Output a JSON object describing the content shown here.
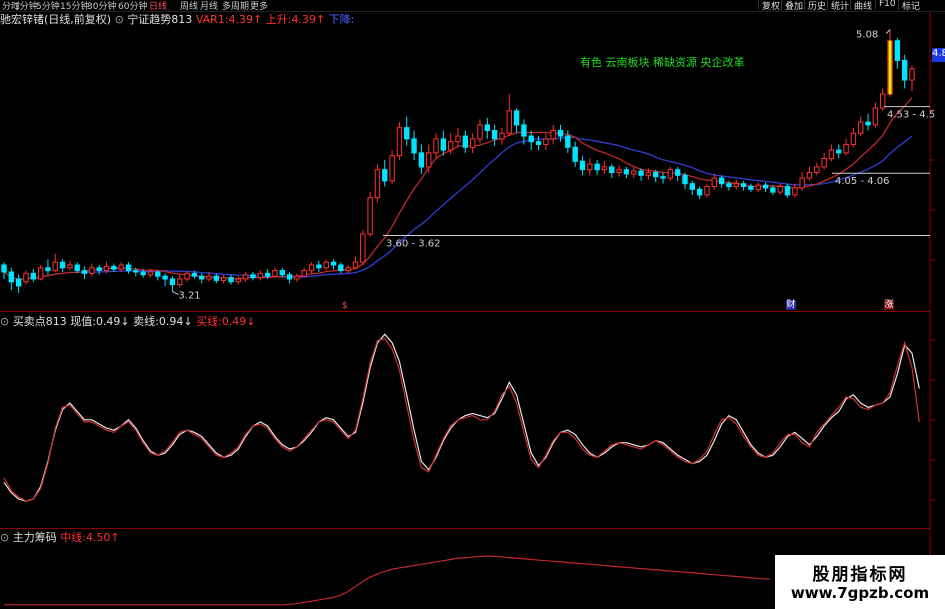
{
  "toolbar": {
    "periods": [
      "分时",
      "1分钟",
      "5分钟",
      "15分钟",
      "30分钟",
      "60分钟",
      "日线",
      "周线",
      "月线",
      "多周期",
      "更多"
    ],
    "active_period": "日线",
    "buttons": [
      "复权",
      "叠加",
      "历史",
      "统计",
      "曲线",
      "F10",
      "标记"
    ]
  },
  "main_legend": {
    "stock": "驰宏锌锗(日线,前复权)",
    "indicator": "宁证趋势813",
    "var1_label": "VAR1:",
    "var1_value": "4.39↑",
    "up_label": "上升:",
    "up_value": "4.39↑",
    "down_label": "下降:"
  },
  "concept_text": "有色  云南板块  稀缺资源  央企改革",
  "price_tags": {
    "right_price": "4.8"
  },
  "sub1_legend": {
    "name": "买卖点813",
    "now_label": "现值:",
    "now_value": "0.49↓",
    "sell_label": "卖线:",
    "sell_value": "0.94↓",
    "buy_label": "买线:",
    "buy_value": "0.49↓"
  },
  "sub2_legend": {
    "name": "主力筹码",
    "mid_label": "中线:",
    "mid_value": "4.50↑"
  },
  "event_markers": [
    "$",
    "财",
    "涨"
  ],
  "watermark": {
    "line1": "股朋指标网",
    "line2": "www.7gpzb.com"
  },
  "colors": {
    "up": "#ff3030",
    "down": "#00e5ff",
    "ma_red": "#c0282a",
    "ma_blue": "#2f3fd0",
    "level": "#d0d0d0",
    "concept": "#22dd22"
  },
  "chart_data": {
    "type": "candlestick",
    "title": "驰宏锌锗(日线,前复权)",
    "price_annotations": [
      {
        "label": "3.21",
        "value": 3.21
      },
      {
        "label": "5.08",
        "value": 5.08
      }
    ],
    "levels": [
      {
        "label": "3.60 - 3.62",
        "value": 3.61
      },
      {
        "label": "4.05 - 4.06",
        "value": 4.055
      },
      {
        "label": "4.53 - 4.5",
        "value": 4.53
      }
    ],
    "ylim": [
      3.15,
      5.12
    ],
    "candles": [
      [
        3.4,
        3.35,
        3.42,
        3.3
      ],
      [
        3.35,
        3.28,
        3.38,
        3.22
      ],
      [
        3.3,
        3.25,
        3.33,
        3.2
      ],
      [
        3.28,
        3.34,
        3.36,
        3.26
      ],
      [
        3.34,
        3.3,
        3.37,
        3.28
      ],
      [
        3.3,
        3.38,
        3.4,
        3.29
      ],
      [
        3.38,
        3.36,
        3.44,
        3.33
      ],
      [
        3.36,
        3.42,
        3.48,
        3.35
      ],
      [
        3.42,
        3.38,
        3.44,
        3.35
      ],
      [
        3.38,
        3.4,
        3.43,
        3.36
      ],
      [
        3.4,
        3.36,
        3.42,
        3.34
      ],
      [
        3.36,
        3.34,
        3.39,
        3.3
      ],
      [
        3.34,
        3.38,
        3.41,
        3.32
      ],
      [
        3.38,
        3.36,
        3.4,
        3.33
      ],
      [
        3.36,
        3.39,
        3.42,
        3.34
      ],
      [
        3.39,
        3.37,
        3.41,
        3.35
      ],
      [
        3.37,
        3.4,
        3.42,
        3.35
      ],
      [
        3.4,
        3.36,
        3.42,
        3.34
      ],
      [
        3.36,
        3.35,
        3.38,
        3.32
      ],
      [
        3.35,
        3.33,
        3.37,
        3.31
      ],
      [
        3.33,
        3.35,
        3.37,
        3.31
      ],
      [
        3.35,
        3.32,
        3.36,
        3.29
      ],
      [
        3.32,
        3.3,
        3.34,
        3.25
      ],
      [
        3.3,
        3.26,
        3.32,
        3.21
      ],
      [
        3.26,
        3.3,
        3.33,
        3.24
      ],
      [
        3.3,
        3.34,
        3.36,
        3.28
      ],
      [
        3.34,
        3.32,
        3.36,
        3.3
      ],
      [
        3.32,
        3.3,
        3.34,
        3.27
      ],
      [
        3.3,
        3.32,
        3.35,
        3.28
      ],
      [
        3.32,
        3.29,
        3.34,
        3.27
      ],
      [
        3.29,
        3.31,
        3.33,
        3.27
      ],
      [
        3.31,
        3.28,
        3.33,
        3.26
      ],
      [
        3.28,
        3.3,
        3.32,
        3.26
      ],
      [
        3.3,
        3.33,
        3.35,
        3.28
      ],
      [
        3.33,
        3.31,
        3.35,
        3.29
      ],
      [
        3.31,
        3.34,
        3.36,
        3.29
      ],
      [
        3.34,
        3.32,
        3.37,
        3.3
      ],
      [
        3.32,
        3.36,
        3.38,
        3.31
      ],
      [
        3.36,
        3.33,
        3.38,
        3.31
      ],
      [
        3.33,
        3.3,
        3.35,
        3.27
      ],
      [
        3.3,
        3.32,
        3.34,
        3.28
      ],
      [
        3.32,
        3.36,
        3.38,
        3.31
      ],
      [
        3.36,
        3.4,
        3.42,
        3.34
      ],
      [
        3.4,
        3.38,
        3.43,
        3.35
      ],
      [
        3.38,
        3.42,
        3.44,
        3.36
      ],
      [
        3.42,
        3.4,
        3.44,
        3.37
      ],
      [
        3.4,
        3.36,
        3.42,
        3.34
      ],
      [
        3.36,
        3.38,
        3.4,
        3.34
      ],
      [
        3.38,
        3.42,
        3.46,
        3.37
      ],
      [
        3.42,
        3.62,
        3.65,
        3.4
      ],
      [
        3.62,
        3.88,
        3.92,
        3.6
      ],
      [
        3.88,
        4.08,
        4.12,
        3.85
      ],
      [
        4.08,
        4.0,
        4.15,
        3.96
      ],
      [
        4.0,
        4.18,
        4.22,
        3.98
      ],
      [
        4.18,
        4.38,
        4.42,
        4.15
      ],
      [
        4.38,
        4.3,
        4.46,
        4.25
      ],
      [
        4.3,
        4.2,
        4.36,
        4.15
      ],
      [
        4.2,
        4.1,
        4.26,
        4.05
      ],
      [
        4.1,
        4.2,
        4.26,
        4.06
      ],
      [
        4.2,
        4.3,
        4.34,
        4.16
      ],
      [
        4.3,
        4.22,
        4.36,
        4.18
      ],
      [
        4.22,
        4.28,
        4.34,
        4.19
      ],
      [
        4.28,
        4.32,
        4.38,
        4.24
      ],
      [
        4.32,
        4.24,
        4.36,
        4.2
      ],
      [
        4.24,
        4.3,
        4.34,
        4.2
      ],
      [
        4.3,
        4.4,
        4.44,
        4.27
      ],
      [
        4.4,
        4.36,
        4.45,
        4.3
      ],
      [
        4.36,
        4.3,
        4.4,
        4.25
      ],
      [
        4.3,
        4.34,
        4.38,
        4.26
      ],
      [
        4.34,
        4.5,
        4.62,
        4.32
      ],
      [
        4.5,
        4.4,
        4.52,
        4.34
      ],
      [
        4.4,
        4.32,
        4.44,
        4.26
      ],
      [
        4.32,
        4.28,
        4.36,
        4.22
      ],
      [
        4.28,
        4.26,
        4.32,
        4.22
      ],
      [
        4.26,
        4.3,
        4.34,
        4.22
      ],
      [
        4.3,
        4.36,
        4.4,
        4.26
      ],
      [
        4.36,
        4.32,
        4.4,
        4.28
      ],
      [
        4.32,
        4.24,
        4.36,
        4.2
      ],
      [
        4.24,
        4.14,
        4.28,
        4.1
      ],
      [
        4.14,
        4.08,
        4.18,
        4.04
      ],
      [
        4.08,
        4.12,
        4.16,
        4.04
      ],
      [
        4.12,
        4.08,
        4.15,
        4.04
      ],
      [
        4.08,
        4.1,
        4.14,
        4.05
      ],
      [
        4.1,
        4.06,
        4.12,
        4.02
      ],
      [
        4.06,
        4.08,
        4.11,
        4.03
      ],
      [
        4.08,
        4.05,
        4.1,
        4.02
      ],
      [
        4.05,
        4.07,
        4.1,
        4.02
      ],
      [
        4.07,
        4.04,
        4.09,
        4.0
      ],
      [
        4.04,
        4.06,
        4.09,
        4.01
      ],
      [
        4.06,
        4.03,
        4.08,
        3.99
      ],
      [
        4.03,
        4.02,
        4.06,
        3.98
      ],
      [
        4.02,
        4.08,
        4.1,
        4.0
      ],
      [
        4.08,
        4.04,
        4.1,
        4.0
      ],
      [
        4.04,
        3.98,
        4.06,
        3.94
      ],
      [
        3.98,
        3.94,
        4.0,
        3.9
      ],
      [
        3.94,
        3.9,
        3.96,
        3.87
      ],
      [
        3.9,
        3.96,
        3.98,
        3.88
      ],
      [
        3.96,
        4.02,
        4.05,
        3.94
      ],
      [
        4.02,
        3.98,
        4.04,
        3.95
      ],
      [
        3.98,
        3.96,
        4.0,
        3.93
      ],
      [
        3.96,
        3.98,
        4.01,
        3.94
      ],
      [
        3.98,
        3.96,
        4.0,
        3.93
      ],
      [
        3.96,
        3.94,
        3.98,
        3.92
      ],
      [
        3.94,
        3.97,
        3.99,
        3.92
      ],
      [
        3.97,
        3.95,
        3.99,
        3.92
      ],
      [
        3.95,
        3.92,
        3.97,
        3.9
      ],
      [
        3.92,
        3.96,
        3.98,
        3.9
      ],
      [
        3.96,
        3.9,
        3.98,
        3.88
      ],
      [
        3.9,
        3.95,
        3.98,
        3.88
      ],
      [
        3.95,
        4.02,
        4.06,
        3.93
      ],
      [
        4.02,
        4.06,
        4.1,
        4.0
      ],
      [
        4.06,
        4.1,
        4.13,
        4.04
      ],
      [
        4.1,
        4.16,
        4.2,
        4.08
      ],
      [
        4.16,
        4.22,
        4.26,
        4.14
      ],
      [
        4.22,
        4.2,
        4.26,
        4.16
      ],
      [
        4.2,
        4.26,
        4.3,
        4.18
      ],
      [
        4.26,
        4.34,
        4.38,
        4.24
      ],
      [
        4.34,
        4.42,
        4.46,
        4.32
      ],
      [
        4.42,
        4.4,
        4.48,
        4.36
      ],
      [
        4.4,
        4.52,
        4.56,
        4.38
      ],
      [
        4.52,
        4.62,
        4.66,
        4.5
      ],
      [
        4.62,
        5.0,
        5.08,
        4.6
      ],
      [
        5.0,
        4.86,
        5.02,
        4.8
      ],
      [
        4.86,
        4.72,
        4.9,
        4.66
      ],
      [
        4.72,
        4.8,
        4.82,
        4.64
      ]
    ],
    "line_red_label": "VAR1",
    "sub1": {
      "title": "买卖点813",
      "sell_line": [
        0.2,
        0.15,
        0.12,
        0.11,
        0.12,
        0.18,
        0.3,
        0.45,
        0.55,
        0.58,
        0.54,
        0.5,
        0.5,
        0.48,
        0.46,
        0.45,
        0.47,
        0.5,
        0.46,
        0.4,
        0.35,
        0.33,
        0.34,
        0.38,
        0.43,
        0.45,
        0.44,
        0.42,
        0.38,
        0.34,
        0.32,
        0.33,
        0.36,
        0.42,
        0.47,
        0.49,
        0.47,
        0.42,
        0.38,
        0.36,
        0.37,
        0.4,
        0.44,
        0.49,
        0.51,
        0.5,
        0.46,
        0.42,
        0.44,
        0.58,
        0.75,
        0.87,
        0.91,
        0.87,
        0.78,
        0.62,
        0.45,
        0.3,
        0.26,
        0.32,
        0.4,
        0.46,
        0.5,
        0.52,
        0.53,
        0.52,
        0.51,
        0.53,
        0.6,
        0.68,
        0.62,
        0.48,
        0.34,
        0.28,
        0.32,
        0.39,
        0.44,
        0.45,
        0.43,
        0.38,
        0.34,
        0.32,
        0.34,
        0.37,
        0.39,
        0.39,
        0.38,
        0.37,
        0.38,
        0.4,
        0.39,
        0.36,
        0.33,
        0.31,
        0.29,
        0.3,
        0.33,
        0.4,
        0.48,
        0.52,
        0.5,
        0.44,
        0.38,
        0.34,
        0.32,
        0.33,
        0.37,
        0.42,
        0.44,
        0.41,
        0.38,
        0.42,
        0.47,
        0.51,
        0.54,
        0.6,
        0.62,
        0.58,
        0.56,
        0.57,
        0.58,
        0.61,
        0.72,
        0.86,
        0.82,
        0.65
      ],
      "buy_line": [
        0.22,
        0.16,
        0.13,
        0.11,
        0.12,
        0.17,
        0.29,
        0.46,
        0.56,
        0.57,
        0.53,
        0.49,
        0.49,
        0.47,
        0.45,
        0.44,
        0.47,
        0.49,
        0.45,
        0.39,
        0.34,
        0.33,
        0.35,
        0.39,
        0.44,
        0.45,
        0.43,
        0.41,
        0.37,
        0.33,
        0.32,
        0.34,
        0.37,
        0.43,
        0.47,
        0.48,
        0.46,
        0.41,
        0.37,
        0.35,
        0.37,
        0.41,
        0.45,
        0.49,
        0.5,
        0.49,
        0.45,
        0.41,
        0.45,
        0.6,
        0.77,
        0.88,
        0.89,
        0.84,
        0.74,
        0.57,
        0.4,
        0.27,
        0.25,
        0.33,
        0.41,
        0.47,
        0.5,
        0.51,
        0.52,
        0.5,
        0.5,
        0.54,
        0.62,
        0.66,
        0.58,
        0.44,
        0.31,
        0.27,
        0.33,
        0.4,
        0.44,
        0.44,
        0.41,
        0.36,
        0.33,
        0.32,
        0.35,
        0.38,
        0.39,
        0.38,
        0.37,
        0.36,
        0.38,
        0.4,
        0.38,
        0.35,
        0.32,
        0.3,
        0.29,
        0.31,
        0.35,
        0.43,
        0.5,
        0.51,
        0.48,
        0.42,
        0.37,
        0.33,
        0.32,
        0.34,
        0.39,
        0.43,
        0.43,
        0.39,
        0.37,
        0.44,
        0.48,
        0.52,
        0.56,
        0.61,
        0.6,
        0.56,
        0.55,
        0.57,
        0.58,
        0.63,
        0.76,
        0.87,
        0.75,
        0.49
      ]
    },
    "sub2": {
      "title": "主力筹码",
      "series": [
        {
          "name": "中线",
          "values": [
            0.02,
            0.02,
            0.02,
            0.02,
            0.02,
            0.02,
            0.02,
            0.02,
            0.02,
            0.02,
            0.02,
            0.02,
            0.02,
            0.02,
            0.02,
            0.02,
            0.02,
            0.02,
            0.02,
            0.02,
            0.02,
            0.02,
            0.02,
            0.02,
            0.02,
            0.02,
            0.02,
            0.02,
            0.02,
            0.02,
            0.02,
            0.02,
            0.02,
            0.02,
            0.02,
            0.02,
            0.02,
            0.02,
            0.02,
            0.02,
            0.02,
            0.03,
            0.04,
            0.06,
            0.08,
            0.1,
            0.12,
            0.14,
            0.17,
            0.22,
            0.3,
            0.38,
            0.46,
            0.52,
            0.57,
            0.61,
            0.64,
            0.66,
            0.68,
            0.7,
            0.72,
            0.74,
            0.76,
            0.78,
            0.8,
            0.82,
            0.83,
            0.84,
            0.85,
            0.86,
            0.86,
            0.85,
            0.84,
            0.83,
            0.82,
            0.81,
            0.8,
            0.79,
            0.78,
            0.77,
            0.76,
            0.75,
            0.74,
            0.73,
            0.72,
            0.71,
            0.7,
            0.69,
            0.68,
            0.67,
            0.66,
            0.65,
            0.64,
            0.63,
            0.62,
            0.61,
            0.6,
            0.59,
            0.58,
            0.57,
            0.56,
            0.55,
            0.54,
            0.53,
            0.52,
            0.51,
            0.5,
            0.49,
            0.48,
            0.47,
            0.46
          ]
        }
      ]
    }
  }
}
